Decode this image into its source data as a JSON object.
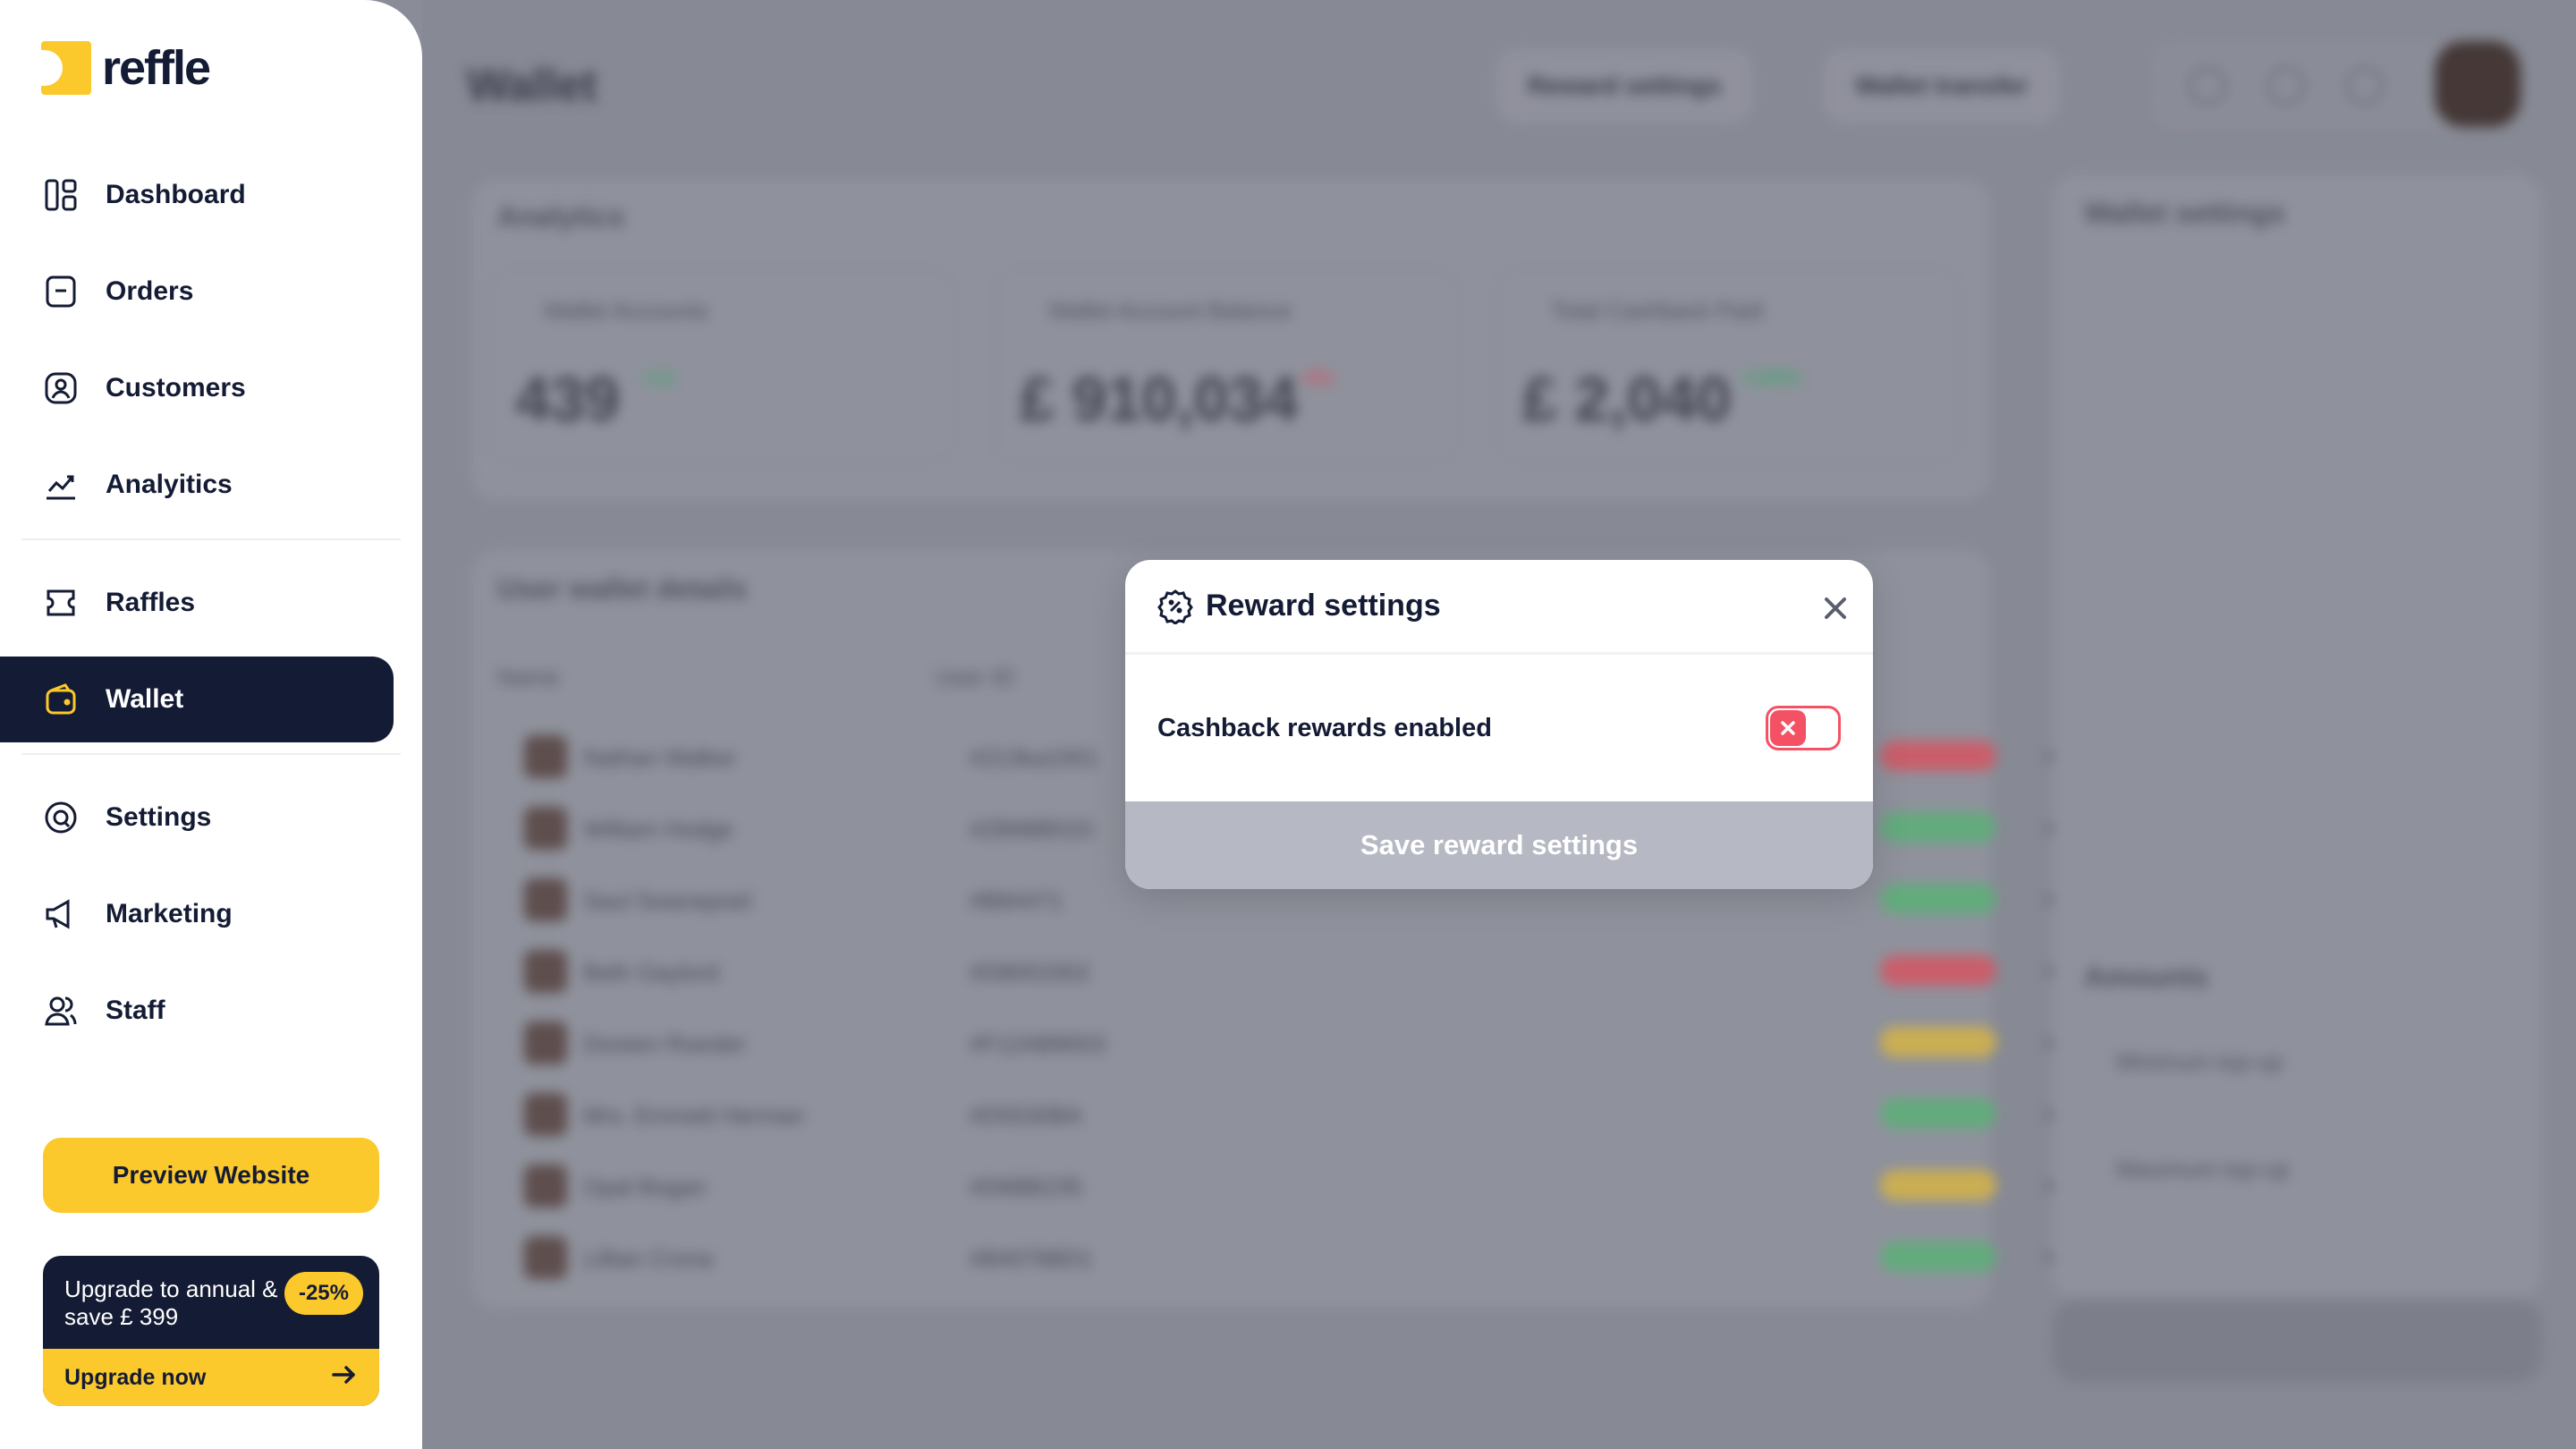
{
  "brand": {
    "name": "reffle",
    "accent": "#fbc92c",
    "navy": "#141b34"
  },
  "sidebar": {
    "items": [
      {
        "label": "Dashboard",
        "icon": "dashboard-icon"
      },
      {
        "label": "Orders",
        "icon": "orders-icon"
      },
      {
        "label": "Customers",
        "icon": "customers-icon"
      },
      {
        "label": "Analyitics",
        "icon": "analytics-icon"
      },
      {
        "label": "Raffles",
        "icon": "raffles-icon"
      },
      {
        "label": "Wallet",
        "icon": "wallet-icon",
        "active": true
      },
      {
        "label": "Settings",
        "icon": "settings-icon"
      },
      {
        "label": "Marketing",
        "icon": "megaphone-icon"
      },
      {
        "label": "Staff",
        "icon": "staff-icon"
      }
    ],
    "preview_label": "Preview Website",
    "upgrade": {
      "text": "Upgrade to annual & save £ 399",
      "badge": "-25%",
      "cta": "Upgrade now"
    }
  },
  "background": {
    "page_title": "Wallet",
    "buttons": [
      "Reward settings",
      "Wallet transfer"
    ],
    "analytics_title": "Analytics",
    "stats": [
      {
        "label": "Wallet Accounts",
        "value": "439",
        "badge": "+12",
        "badge_color": "#3fae6b"
      },
      {
        "label": "Wallet Account Balance",
        "value": "£ 910,034",
        "badge": "-3%",
        "badge_color": "#e0505f"
      },
      {
        "label": "Total Cashback Paid",
        "value": "£ 2,040",
        "badge": "+105%",
        "badge_color": "#3fae6b"
      }
    ],
    "table_title": "User wallet details",
    "table_headers": [
      "Name",
      "User ID"
    ],
    "rows": [
      {
        "name": "Nathan Walker",
        "id": "#213ka1001",
        "status": "#d85a66"
      },
      {
        "name": "William Hodge",
        "id": "#ZB98B533",
        "status": "#5fb47b"
      },
      {
        "name": "Saul Swanepoel",
        "id": "#B84471",
        "status": "#5fb47b"
      },
      {
        "name": "Beth Gaylord",
        "id": "#D8053302",
        "status": "#d85a66"
      },
      {
        "name": "Doreen Roesler",
        "id": "#F12AB9003",
        "status": "#d9b84a"
      },
      {
        "name": "Mrs. Emmett Herman",
        "id": "#D5530BA",
        "status": "#5fb47b"
      },
      {
        "name": "Opal Bogan",
        "id": "#D6BB235",
        "status": "#d9b84a"
      },
      {
        "name": "Lillian Crona",
        "id": "#B40788D1",
        "status": "#5fb47b"
      }
    ],
    "right_panel_title": "Wallet settings",
    "amounts_title": "Amounts",
    "amount_rows": [
      "Minimum top-up",
      "Maximum top-up"
    ]
  },
  "modal": {
    "title": "Reward settings",
    "setting_label": "Cashback rewards enabled",
    "toggle_enabled": false,
    "save_label": "Save reward settings",
    "toggle_color": "#f55164"
  }
}
